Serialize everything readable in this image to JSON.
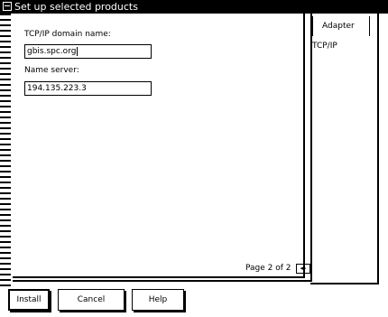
{
  "window": {
    "title": "Set up selected products"
  },
  "form": {
    "domain_label": "TCP/IP domain name:",
    "domain_value": "gbis.spc.org",
    "nameserver_label": "Name server:",
    "nameserver_value": "194.135.223.3"
  },
  "tabs": [
    {
      "label": "Adapter",
      "active": true
    },
    {
      "label": "TCP/IP",
      "active": false
    }
  ],
  "pagination": {
    "text": "Page 2 of 2",
    "arrows": "◂▸"
  },
  "buttons": {
    "install": "Install",
    "cancel": "Cancel",
    "help": "Help"
  }
}
